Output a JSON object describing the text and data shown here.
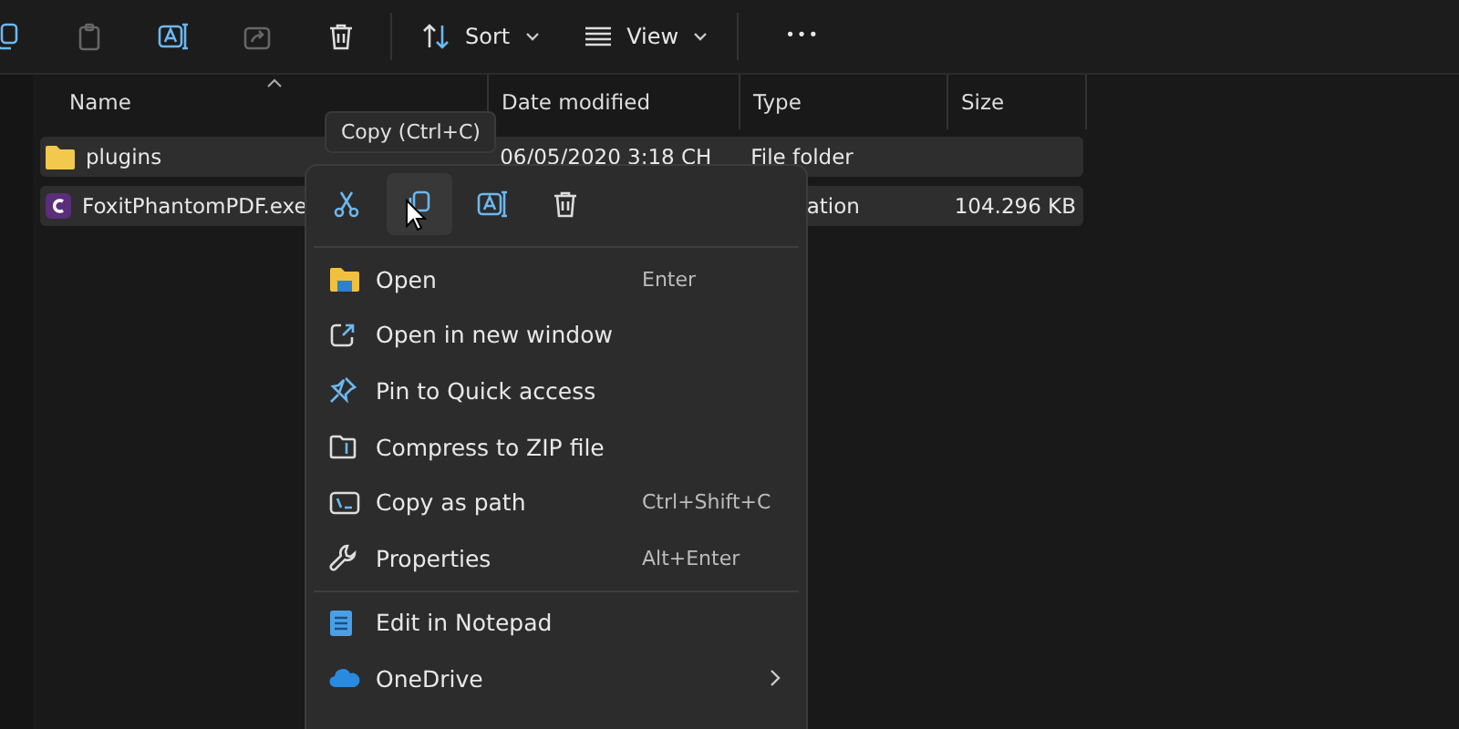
{
  "toolbar": [
    {
      "kind": "copy"
    },
    {
      "kind": "paste",
      "disabled": true
    },
    {
      "kind": "rename"
    },
    {
      "kind": "share",
      "disabled": true
    },
    {
      "kind": "delete"
    },
    {
      "kind": "sort",
      "label": "Sort"
    },
    {
      "kind": "view",
      "label": "View"
    },
    {
      "kind": "more",
      "label": "•••"
    }
  ],
  "columns": [
    "Name",
    "Date modified",
    "Type",
    "Size"
  ],
  "rows": [
    {
      "kind": "folder",
      "name": "plugins",
      "date": "06/05/2020 3:18 CH",
      "type": "File folder",
      "selected": true
    },
    {
      "kind": "app",
      "name": "FoxitPhantomPDF.exe",
      "type": "ation",
      "size": "104.296 KB",
      "selected": true
    }
  ],
  "tooltip": "Copy (Ctrl+C)",
  "quick_actions": [
    {
      "kind": "cut",
      "selected": false
    },
    {
      "kind": "copy",
      "selected": true
    },
    {
      "kind": "rename",
      "selected": false
    },
    {
      "kind": "delete",
      "selected": false
    }
  ],
  "menu_items": [
    {
      "kind": "open",
      "label": "Open",
      "shortcut": "Enter"
    },
    {
      "kind": "newwindow",
      "label": "Open in new window"
    },
    {
      "kind": "pin",
      "label": "Pin to Quick access"
    },
    {
      "kind": "zip",
      "label": "Compress to ZIP file"
    },
    {
      "kind": "path",
      "label": "Copy as path",
      "shortcut": "Ctrl+Shift+C"
    },
    {
      "kind": "props",
      "label": "Properties",
      "shortcut": "Alt+Enter",
      "separator_after": true
    },
    {
      "kind": "notepad",
      "label": "Edit in Notepad"
    },
    {
      "kind": "onedrive",
      "label": "OneDrive",
      "submenu": true
    }
  ]
}
